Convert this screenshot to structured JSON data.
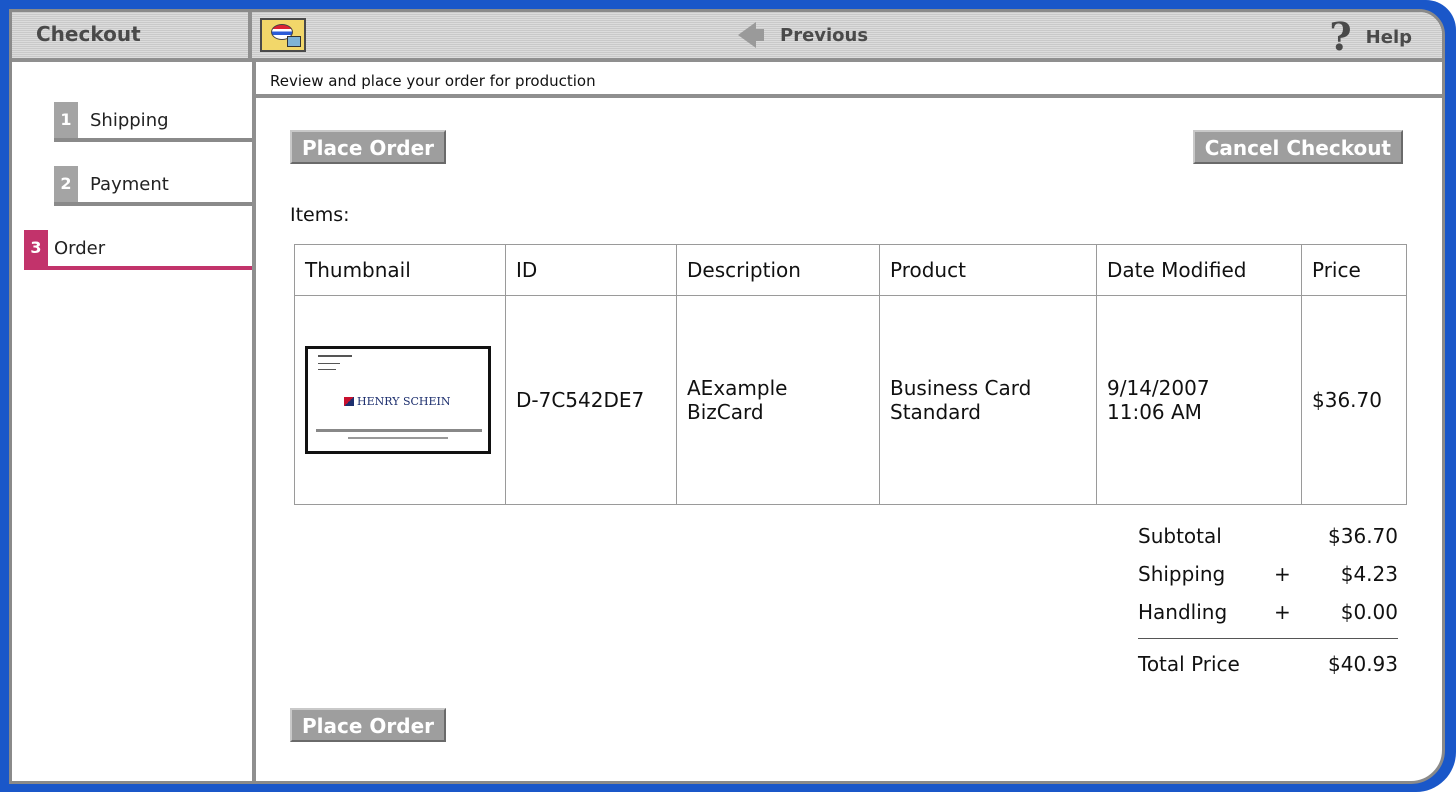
{
  "header": {
    "title": "Checkout",
    "cart_icon": "cart-icon",
    "previous_label": "Previous",
    "help_label": "Help",
    "help_icon": "?"
  },
  "steps": [
    {
      "number": "1",
      "label": "Shipping",
      "active": false
    },
    {
      "number": "2",
      "label": "Payment",
      "active": false
    },
    {
      "number": "3",
      "label": "Order",
      "active": true
    }
  ],
  "colors": {
    "frame": "#1a57c9",
    "active_step": "#c2336b",
    "button": "#9e9e9e"
  },
  "main": {
    "instruction": "Review and place your order for production",
    "place_order_label": "Place Order",
    "cancel_label": "Cancel Checkout",
    "items_label": "Items:"
  },
  "table": {
    "headers": [
      "Thumbnail",
      "ID",
      "Description",
      "Product",
      "Date Modified",
      "Price"
    ],
    "rows": [
      {
        "id": "D-7C542DE7",
        "description_line1": "AExample",
        "description_line2": "BizCard",
        "product_line1": "Business Card",
        "product_line2": "Standard",
        "date_line1": "9/14/2007",
        "date_line2": "11:06 AM",
        "price": "$36.70",
        "thumbnail_logo": "HENRY SCHEIN"
      }
    ]
  },
  "totals": {
    "subtotal_label": "Subtotal",
    "subtotal_value": "$36.70",
    "shipping_label": "Shipping",
    "shipping_op": "+",
    "shipping_value": "$4.23",
    "handling_label": "Handling",
    "handling_op": "+",
    "handling_value": "$0.00",
    "total_label": "Total Price",
    "total_value": "$40.93"
  }
}
